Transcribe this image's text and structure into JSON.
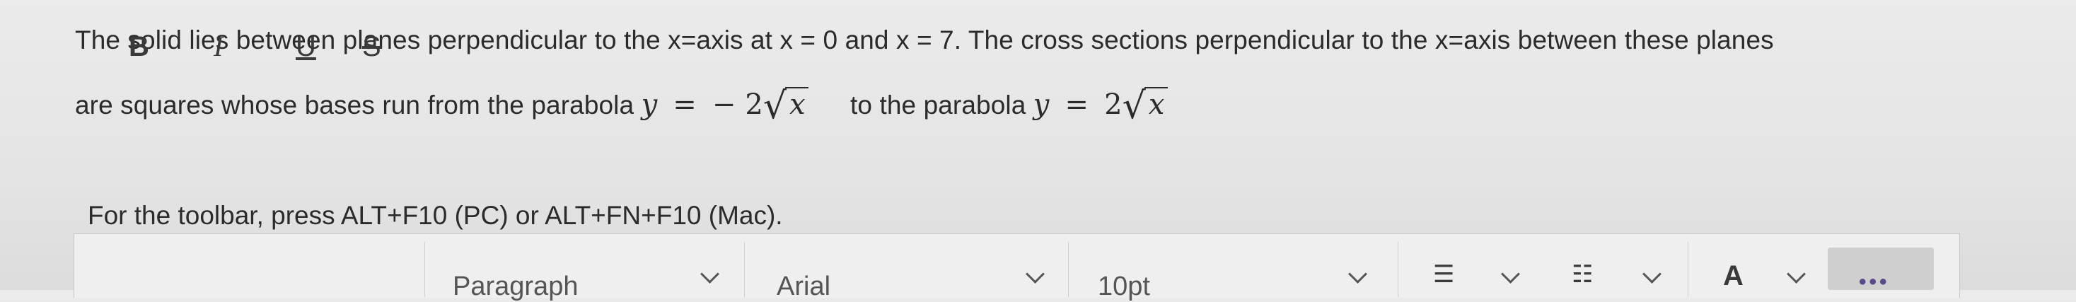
{
  "question": {
    "line1": "The solid lies between planes perpendicular to the x=axis at x = 0 and x = 7. The cross sections perpendicular to the x=axis between these planes",
    "line2_prefix": "are squares whose bases run from the parabola",
    "lower_parabola": {
      "lhs": "y",
      "eq": "=",
      "coef": "− 2",
      "radicand": "x"
    },
    "mid_text": "to the parabola",
    "upper_parabola": {
      "lhs": "y",
      "eq": "=",
      "coef": "2",
      "radicand": "x"
    }
  },
  "instruction": "For the toolbar, press ALT+F10 (PC) or ALT+FN+F10 (Mac).",
  "toolbar": {
    "bold": "B",
    "italic": "I",
    "underline": "U",
    "strikethrough": "S",
    "paragraph": "Paragraph",
    "font": "Arial",
    "size": "10pt",
    "text_color": "A",
    "more": "•••"
  }
}
